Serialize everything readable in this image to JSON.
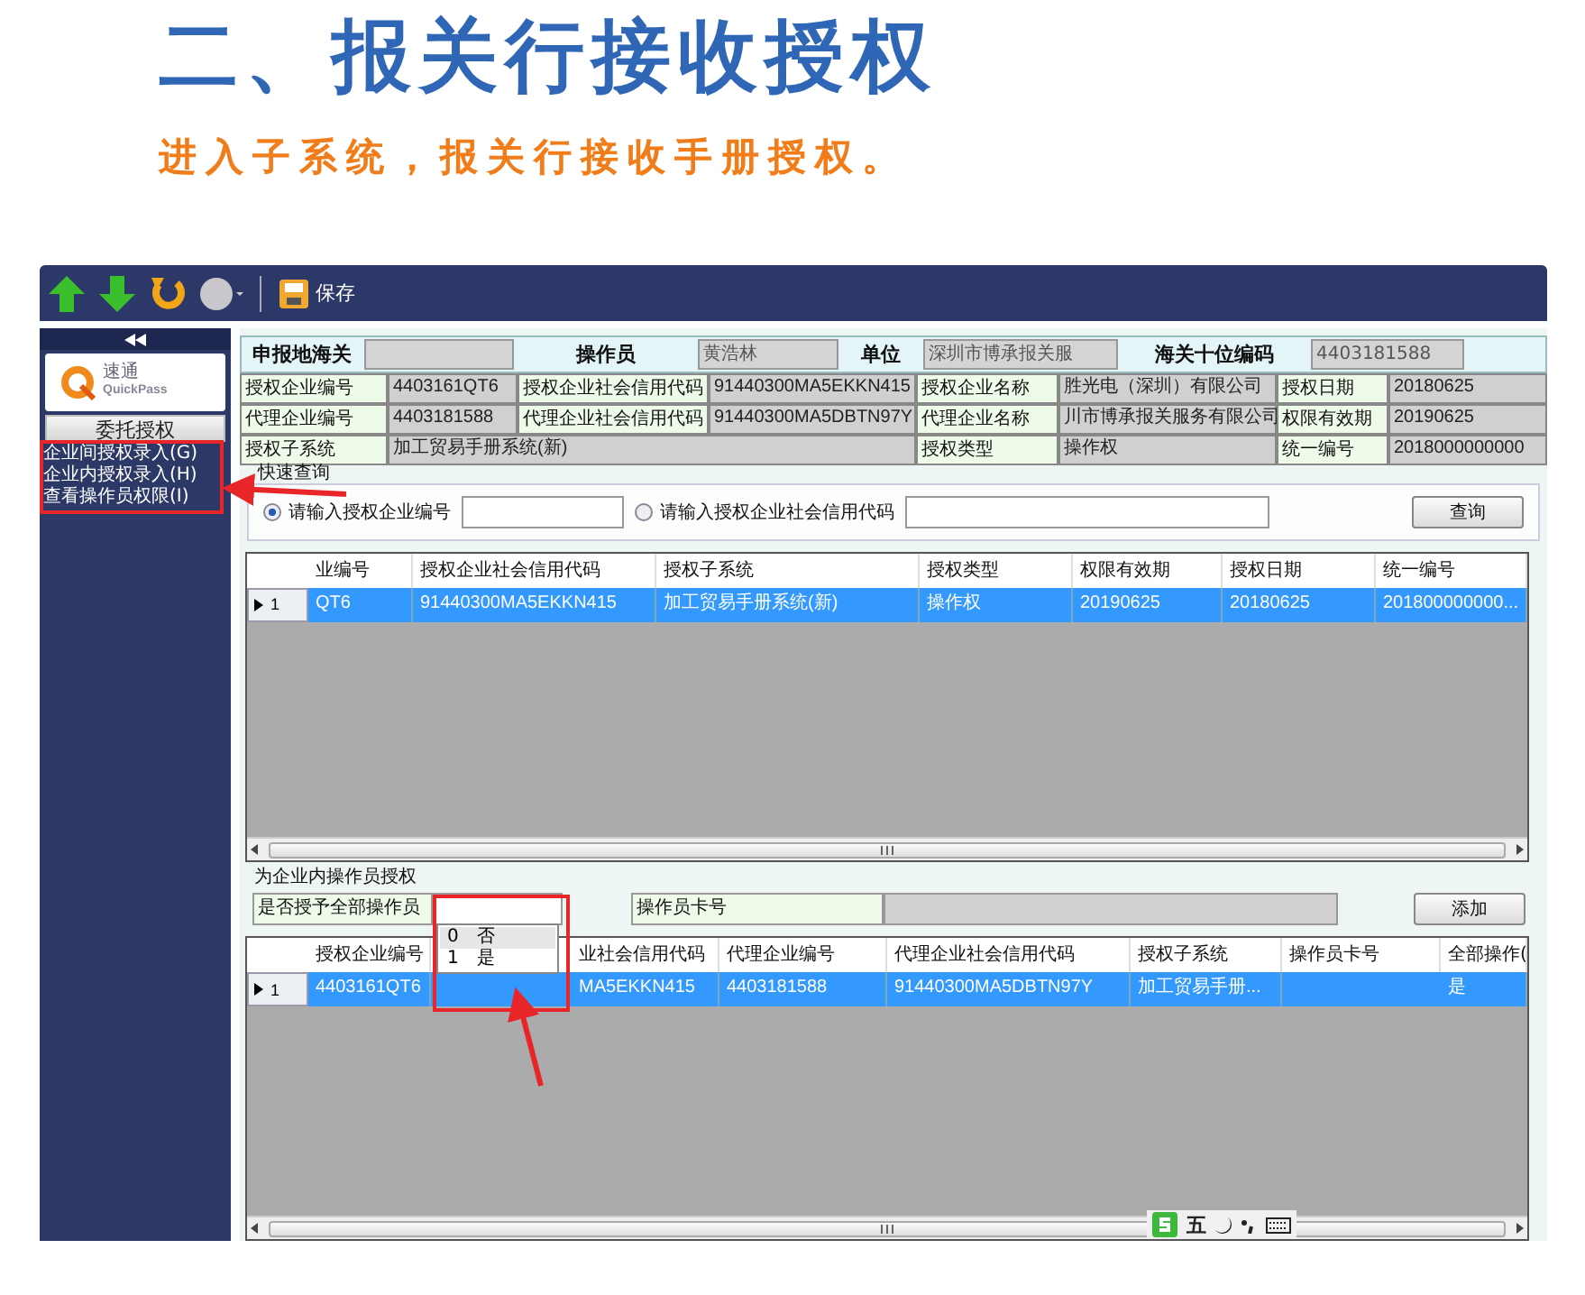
{
  "heading": "二、报关行接收授权",
  "subheading": "进入子系统，报关行接收手册授权。",
  "toolbar": {
    "save_label": "保存"
  },
  "sidebar": {
    "logo_name": "速通",
    "logo_sub": "QuickPass",
    "section_button": "委托授权",
    "menu": [
      {
        "label": "企业间授权录入(G)"
      },
      {
        "label": "企业内授权录入(H)"
      },
      {
        "label": "查看操作员权限(I)"
      }
    ]
  },
  "header_fields": [
    {
      "label": "申报地海关"
    },
    {
      "label": "操作员",
      "value": "黄浩林"
    },
    {
      "label": "单位",
      "value": "深圳市博承报关服"
    },
    {
      "label": "海关十位编码",
      "value": "4403181588"
    }
  ],
  "details": [
    [
      {
        "label": "授权企业编号",
        "value": "4403161QT6"
      },
      {
        "label": "授权企业社会信用代码",
        "value": "91440300MA5EKKN415"
      },
      {
        "label": "授权企业名称",
        "value": "胜光电（深圳）有限公司"
      },
      {
        "label": "授权日期",
        "value": "20180625"
      }
    ],
    [
      {
        "label": "代理企业编号",
        "value": "4403181588"
      },
      {
        "label": "代理企业社会信用代码",
        "value": "91440300MA5DBTN97Y"
      },
      {
        "label": "代理企业名称",
        "value": "川市博承报关服务有限公司"
      },
      {
        "label": "权限有效期",
        "value": "20190625"
      }
    ],
    [
      {
        "label": "授权子系统",
        "value": "加工贸易手册系统(新)",
        "wide": true
      },
      {
        "label": "授权类型",
        "value": "操作权"
      },
      {
        "label": "统一编号",
        "value": "2018000000000"
      }
    ]
  ],
  "quick_query": {
    "title": "快速查询",
    "options": [
      {
        "label": "请输入授权企业编号",
        "selected": true
      },
      {
        "label": "请输入授权企业社会信用代码",
        "selected": false
      }
    ],
    "button": "查询"
  },
  "table1": {
    "columns": [
      "业编号",
      "授权企业社会信用代码",
      "授权子系统",
      "授权类型",
      "权限有效期",
      "授权日期",
      "统一编号"
    ],
    "rows": [
      {
        "index": "1",
        "selected": true,
        "cells": [
          "QT6",
          "91440300MA5EKKN415",
          "加工贸易手册系统(新)",
          "操作权",
          "20190625",
          "20180625",
          "201800000000..."
        ]
      }
    ]
  },
  "operator_section": {
    "title": "为企业内操作员授权",
    "all_label": "是否授予全部操作员",
    "card_label": "操作员卡号",
    "button": "添加",
    "dropdown": [
      {
        "code": "0",
        "label": "否",
        "selected": true
      },
      {
        "code": "1",
        "label": "是",
        "selected": false
      }
    ]
  },
  "table2": {
    "columns": [
      "授权企业编号",
      "业社会信用代码",
      "代理企业编号",
      "代理企业社会信用代码",
      "授权子系统",
      "操作员卡号",
      "全部操作("
    ],
    "rows": [
      {
        "index": "1",
        "selected": true,
        "cells": [
          "4403161QT6",
          "MA5EKKN415",
          "4403181588",
          "91440300MA5DBTN97Y",
          "加工贸易手册...",
          "",
          "是"
        ]
      }
    ]
  },
  "ime": {
    "mode": "五"
  }
}
